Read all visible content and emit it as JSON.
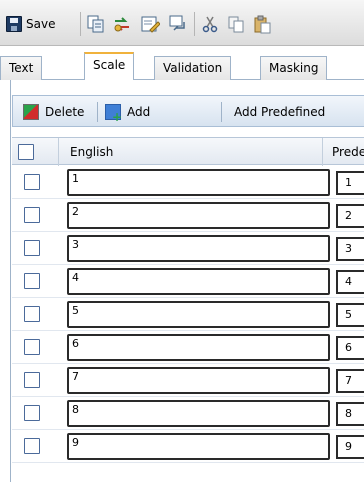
{
  "toolbar": {
    "save_label": "Save",
    "icons": [
      "save-icon",
      "copy-form-icon",
      "swap-icon",
      "edit-icon",
      "export-icon",
      "cut-icon",
      "copy-icon",
      "paste-icon"
    ]
  },
  "tabs": [
    {
      "label": "Text",
      "active": false
    },
    {
      "label": "Scale",
      "active": true
    },
    {
      "label": "Validation",
      "active": false
    },
    {
      "label": "Masking",
      "active": false
    }
  ],
  "grid_toolbar": {
    "delete_label": "Delete",
    "add_label": "Add",
    "add_predefined_label": "Add Predefined"
  },
  "table": {
    "columns": [
      "English",
      "Predefined"
    ],
    "rows": [
      {
        "english": "1",
        "predefined": "1"
      },
      {
        "english": "2",
        "predefined": "2"
      },
      {
        "english": "3",
        "predefined": "3"
      },
      {
        "english": "4",
        "predefined": "4"
      },
      {
        "english": "5",
        "predefined": "5"
      },
      {
        "english": "6",
        "predefined": "6"
      },
      {
        "english": "7",
        "predefined": "7"
      },
      {
        "english": "8",
        "predefined": "8"
      },
      {
        "english": "9",
        "predefined": "9"
      }
    ]
  },
  "colors": {
    "tab_active_accent": "#f0b23c",
    "border_blue": "#9fb3c9"
  }
}
